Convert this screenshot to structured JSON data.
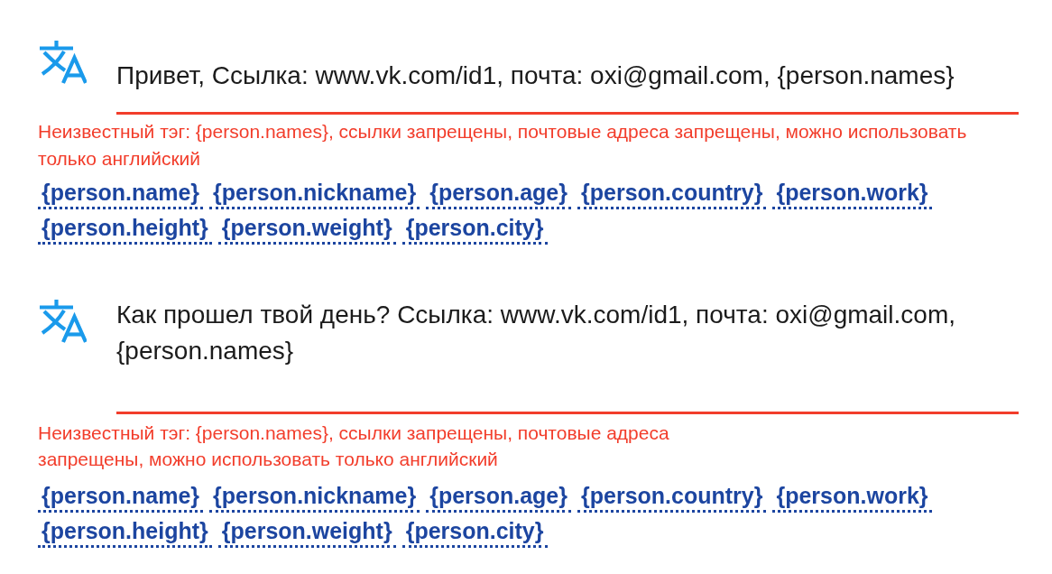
{
  "messages": [
    {
      "text": "Привет, Ссылка: www.vk.com/id1, почта: oxi@gmail.com, {person.names}",
      "invalid": true,
      "error": "Неизвестный тэг: {person.names}, ссылки запрещены, почтовые адреса запрещены, можно использовать только английский",
      "tags": [
        "{person.name}",
        "{person.nickname}",
        "{person.age}",
        "{person.country}",
        "{person.work}",
        "{person.height}",
        "{person.weight}",
        "{person.city}"
      ]
    },
    {
      "text": "Как прошел твой день? Ссылка: www.vk.com/id1, почта: oxi@gmail.com, {person.names}",
      "invalid": true,
      "error": "Неизвестный тэг: {person.names}, ссылки запрещены, почтовые адреса запрещены, можно использовать только английский",
      "tags": [
        "{person.name}",
        "{person.nickname}",
        "{person.age}",
        "{person.country}",
        "{person.work}",
        "{person.height}",
        "{person.weight}",
        "{person.city}"
      ]
    }
  ]
}
